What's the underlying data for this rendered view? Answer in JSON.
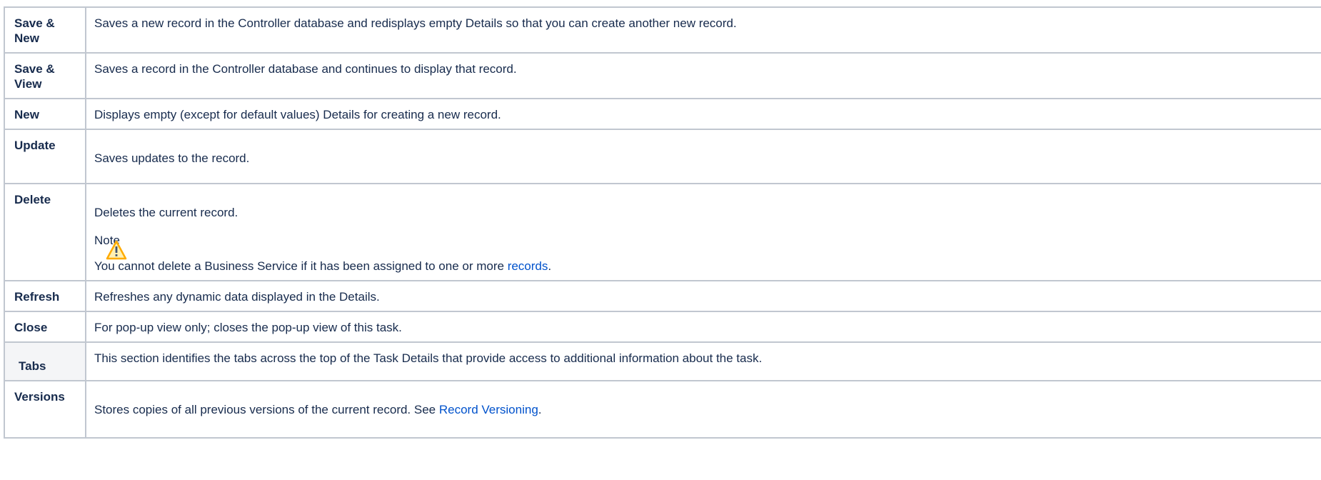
{
  "rows": [
    {
      "label": "Save & New",
      "desc": "Saves a new record in the Controller database and redisplays empty Details so that you can create another new record."
    },
    {
      "label": "Save & View",
      "desc": "Saves a record in the Controller database and continues to display that record."
    },
    {
      "label": "New",
      "desc": "Displays empty (except for default values) Details for creating a new record."
    },
    {
      "label": "Update",
      "desc": "Saves updates to the record."
    },
    {
      "label": "Delete",
      "desc": "Deletes the current record.",
      "note_title": "Note",
      "note_text_before": "You cannot delete a Business Service if it has been assigned to one or more ",
      "note_link": "records",
      "note_text_after": "."
    },
    {
      "label": "Refresh",
      "desc": "Refreshes any dynamic data displayed in the Details."
    },
    {
      "label": "Close",
      "desc": "For pop-up view only; closes the pop-up view of this task."
    },
    {
      "label": "Tabs",
      "desc": "This section identifies the tabs across the top of the Task Details that provide access to additional information about the task."
    },
    {
      "label": "Versions",
      "desc_before": "Stores copies of all previous versions of the current record. See ",
      "desc_link": "Record Versioning",
      "desc_after": "."
    }
  ],
  "icons": {
    "note": "warning-icon",
    "warning_color": "#ffab00"
  }
}
